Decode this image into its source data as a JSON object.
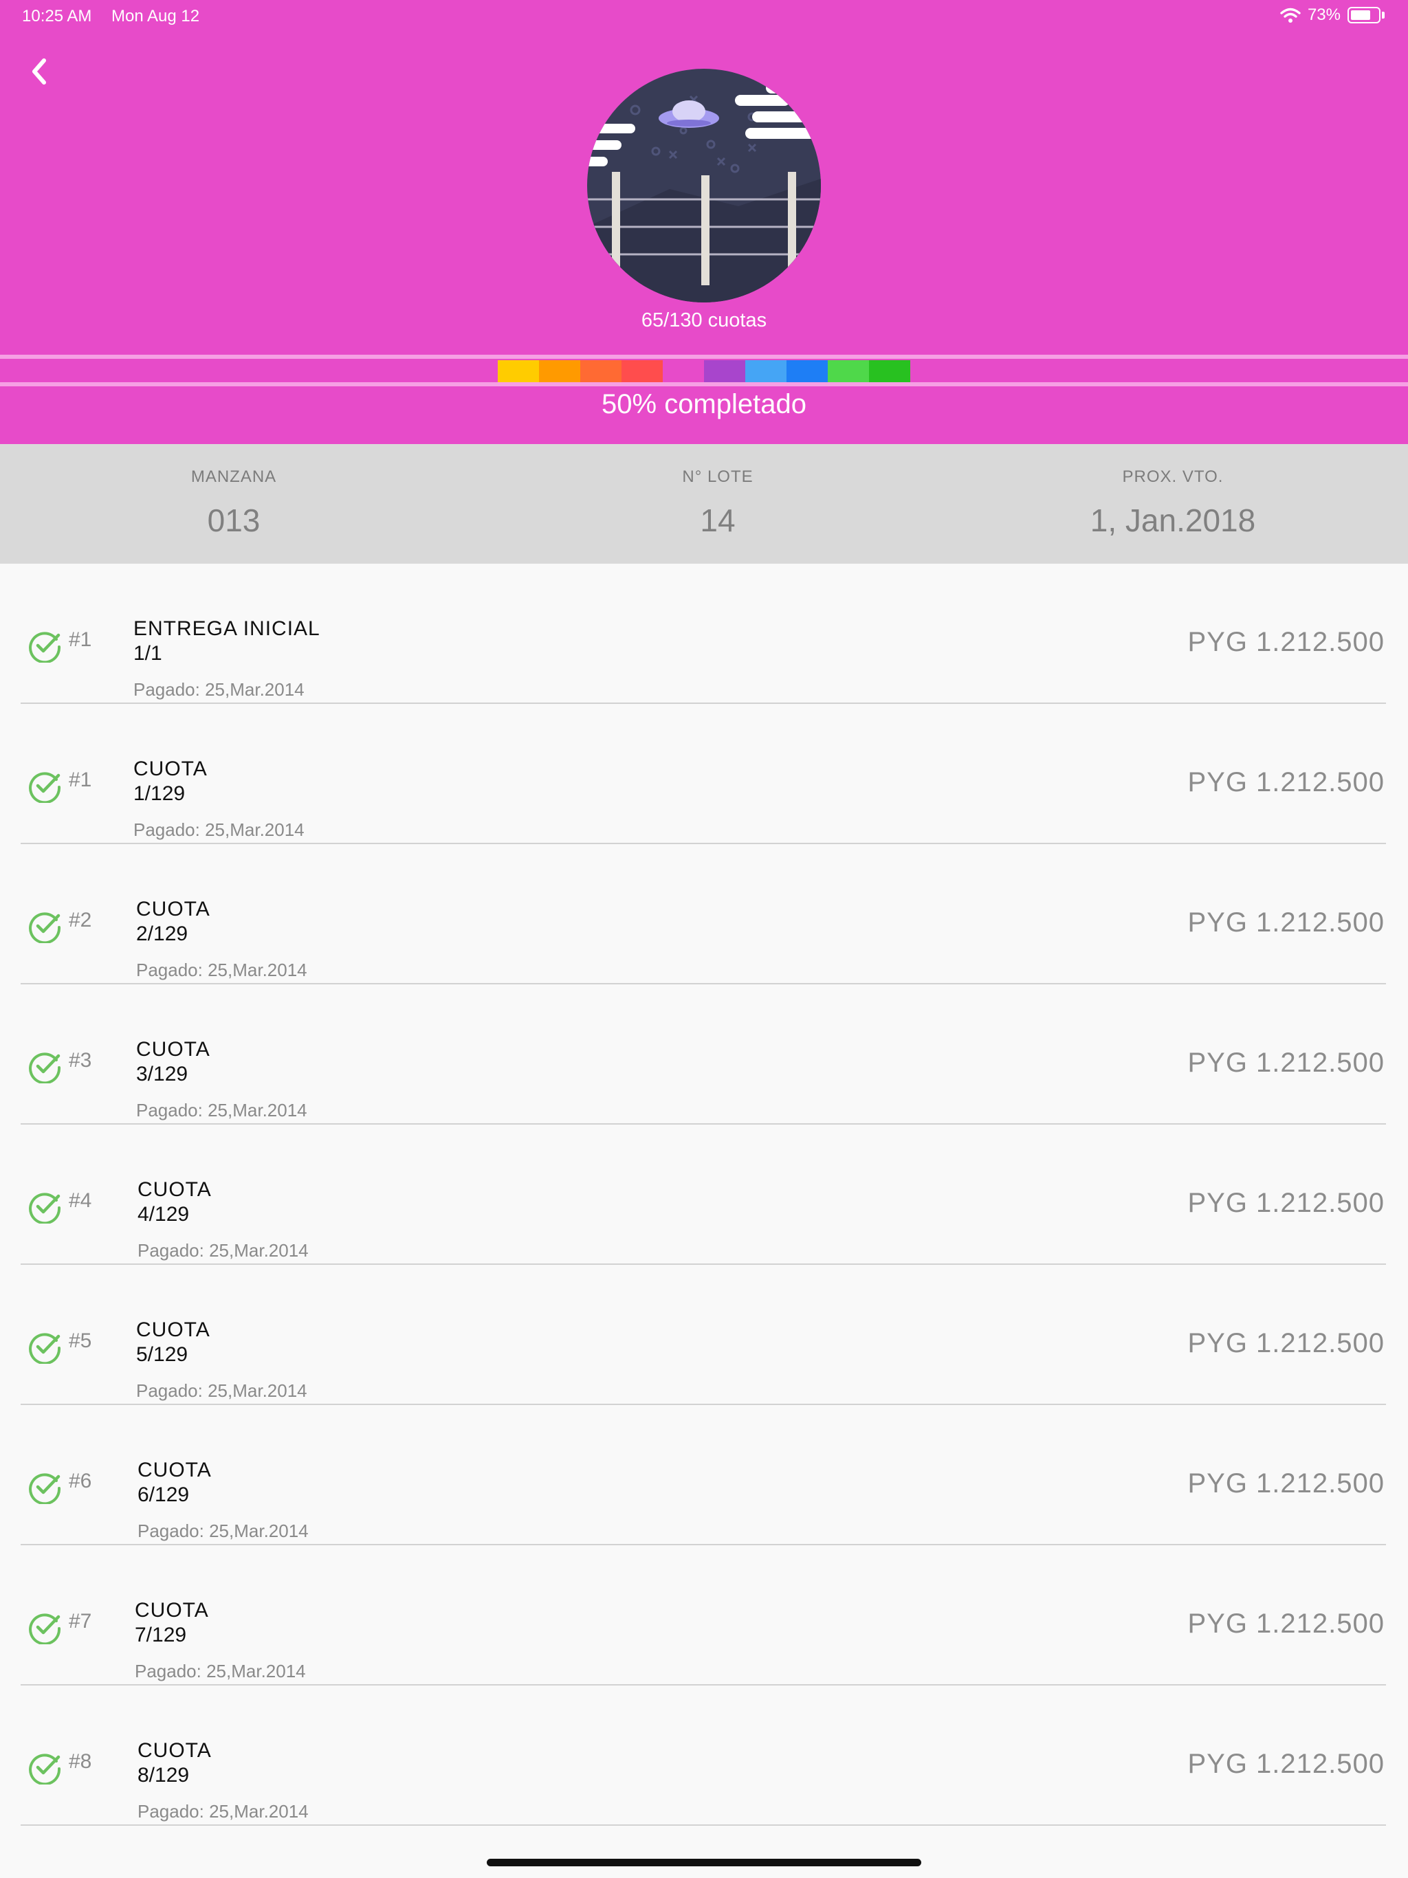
{
  "status_bar": {
    "time": "10:25 AM",
    "date": "Mon Aug 12",
    "battery_text": "73%",
    "battery_level": 0.73
  },
  "header": {
    "back_icon": "chevron-left-icon",
    "avatar_icon": "ufo-fence-night-illustration",
    "quota_count": "65/130 cuotas",
    "progress_label": "50% completado",
    "progress_fraction": 0.5,
    "progress_colors": [
      "#ffcc00",
      "#ff9a00",
      "#ff6a33",
      "#ff4d4d",
      "#e74bc9",
      "#a845cc",
      "#45a5f5",
      "#1e7ef5",
      "#4fd84a",
      "#28c120"
    ],
    "background_color": "#e74bc9"
  },
  "info": {
    "manzana_label": "MANZANA",
    "manzana_value": "013",
    "lote_label": "N° LOTE",
    "lote_value": "14",
    "vto_label": "PROX. VTO.",
    "vto_value": "1, Jan.2018"
  },
  "payments": [
    {
      "number": "#1",
      "type": "ENTREGA INICIAL",
      "fraction": "1/1",
      "paid": "Pagado: 25,Mar.2014",
      "amount": "PYG 1.212.500"
    },
    {
      "number": "#1",
      "type": "CUOTA",
      "fraction": "1/129",
      "paid": "Pagado: 25,Mar.2014",
      "amount": "PYG 1.212.500"
    },
    {
      "number": "#2",
      "type": "CUOTA",
      "fraction": "2/129",
      "paid": "Pagado: 25,Mar.2014",
      "amount": "PYG 1.212.500"
    },
    {
      "number": "#3",
      "type": "CUOTA",
      "fraction": "3/129",
      "paid": "Pagado: 25,Mar.2014",
      "amount": "PYG 1.212.500"
    },
    {
      "number": "#4",
      "type": "CUOTA",
      "fraction": "4/129",
      "paid": "Pagado: 25,Mar.2014",
      "amount": "PYG 1.212.500"
    },
    {
      "number": "#5",
      "type": "CUOTA",
      "fraction": "5/129",
      "paid": "Pagado: 25,Mar.2014",
      "amount": "PYG 1.212.500"
    },
    {
      "number": "#6",
      "type": "CUOTA",
      "fraction": "6/129",
      "paid": "Pagado: 25,Mar.2014",
      "amount": "PYG 1.212.500"
    },
    {
      "number": "#7",
      "type": "CUOTA",
      "fraction": "7/129",
      "paid": "Pagado: 25,Mar.2014",
      "amount": "PYG 1.212.500"
    },
    {
      "number": "#8",
      "type": "CUOTA",
      "fraction": "8/129",
      "paid": "Pagado: 25,Mar.2014",
      "amount": "PYG 1.212.500"
    }
  ],
  "status_icon": "check-circle-icon",
  "check_color": "#6cc25f"
}
